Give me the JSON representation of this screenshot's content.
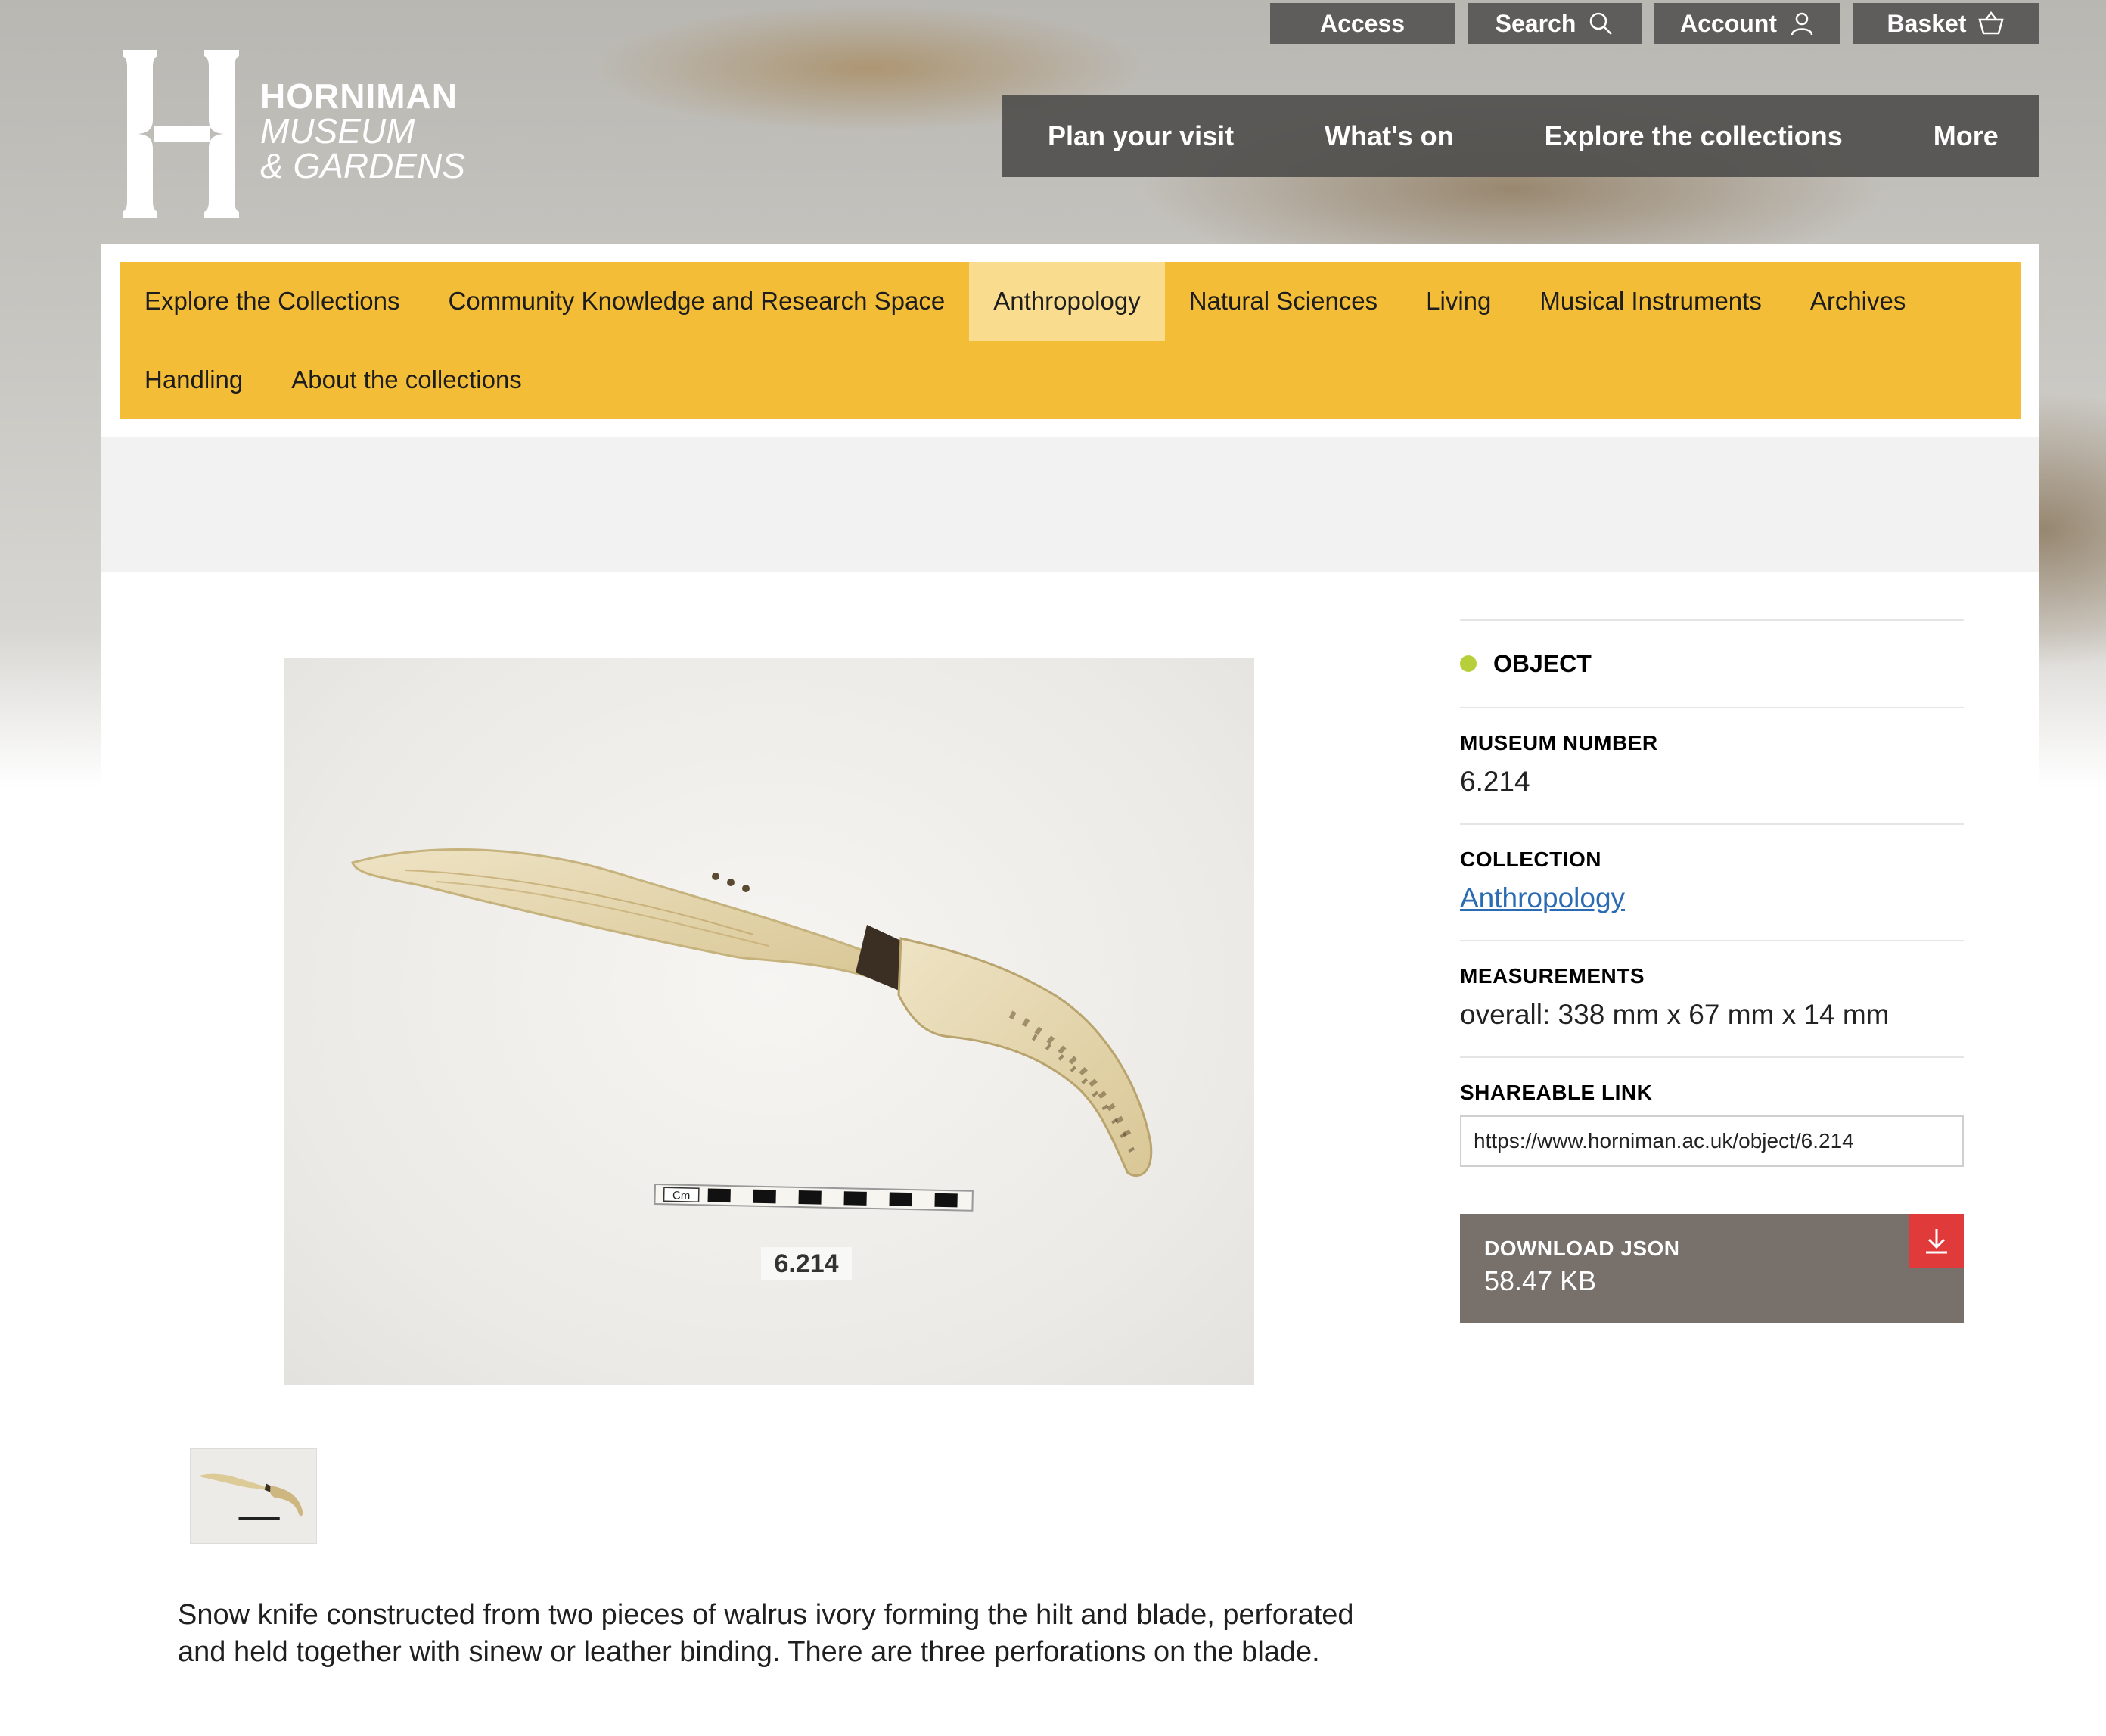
{
  "utility": {
    "access": "Access",
    "search": "Search",
    "account": "Account",
    "basket": "Basket"
  },
  "logo": {
    "line1": "HORNIMAN",
    "line2": "MUSEUM",
    "line3": "& GARDENS"
  },
  "main_nav": [
    {
      "label": "Plan your visit"
    },
    {
      "label": "What's on"
    },
    {
      "label": "Explore the collections"
    },
    {
      "label": "More"
    }
  ],
  "sub_nav": {
    "row1": [
      "Explore the Collections",
      "Community Knowledge and Research Space",
      "Anthropology",
      "Natural Sciences",
      "Living",
      "Musical Instruments",
      "Archives"
    ],
    "row2": [
      "Handling",
      "About the collections"
    ],
    "active": "Anthropology"
  },
  "object": {
    "type": "OBJECT",
    "museum_number_label": "MUSEUM NUMBER",
    "museum_number": "6.214",
    "collection_label": "COLLECTION",
    "collection": "Anthropology",
    "measurements_label": "MEASUREMENTS",
    "measurements": "overall: 338 mm x 67 mm x 14 mm",
    "shareable_link_label": "SHAREABLE LINK",
    "shareable_link": "https://www.horniman.ac.uk/object/6.214",
    "download_label": "DOWNLOAD JSON",
    "download_size": "58.47 KB",
    "image_label": "6.214",
    "scale_label": "Cm",
    "description": "Snow knife constructed from two pieces of walrus ivory forming the hilt and blade, perforated and held together with sinew or leather binding. There are three perforations on the blade."
  },
  "colors": {
    "subnav_bg": "#f3bd38",
    "subnav_active": "#f9dc8e",
    "nav_bg": "#504f4d",
    "dot": "#b7cf3a",
    "download_bg": "#77706b",
    "download_icon": "#e03a3a",
    "link": "#2a6bb3"
  },
  "icons": {
    "search": "search-icon",
    "account": "user-icon",
    "basket": "basket-icon",
    "download": "download-icon"
  }
}
